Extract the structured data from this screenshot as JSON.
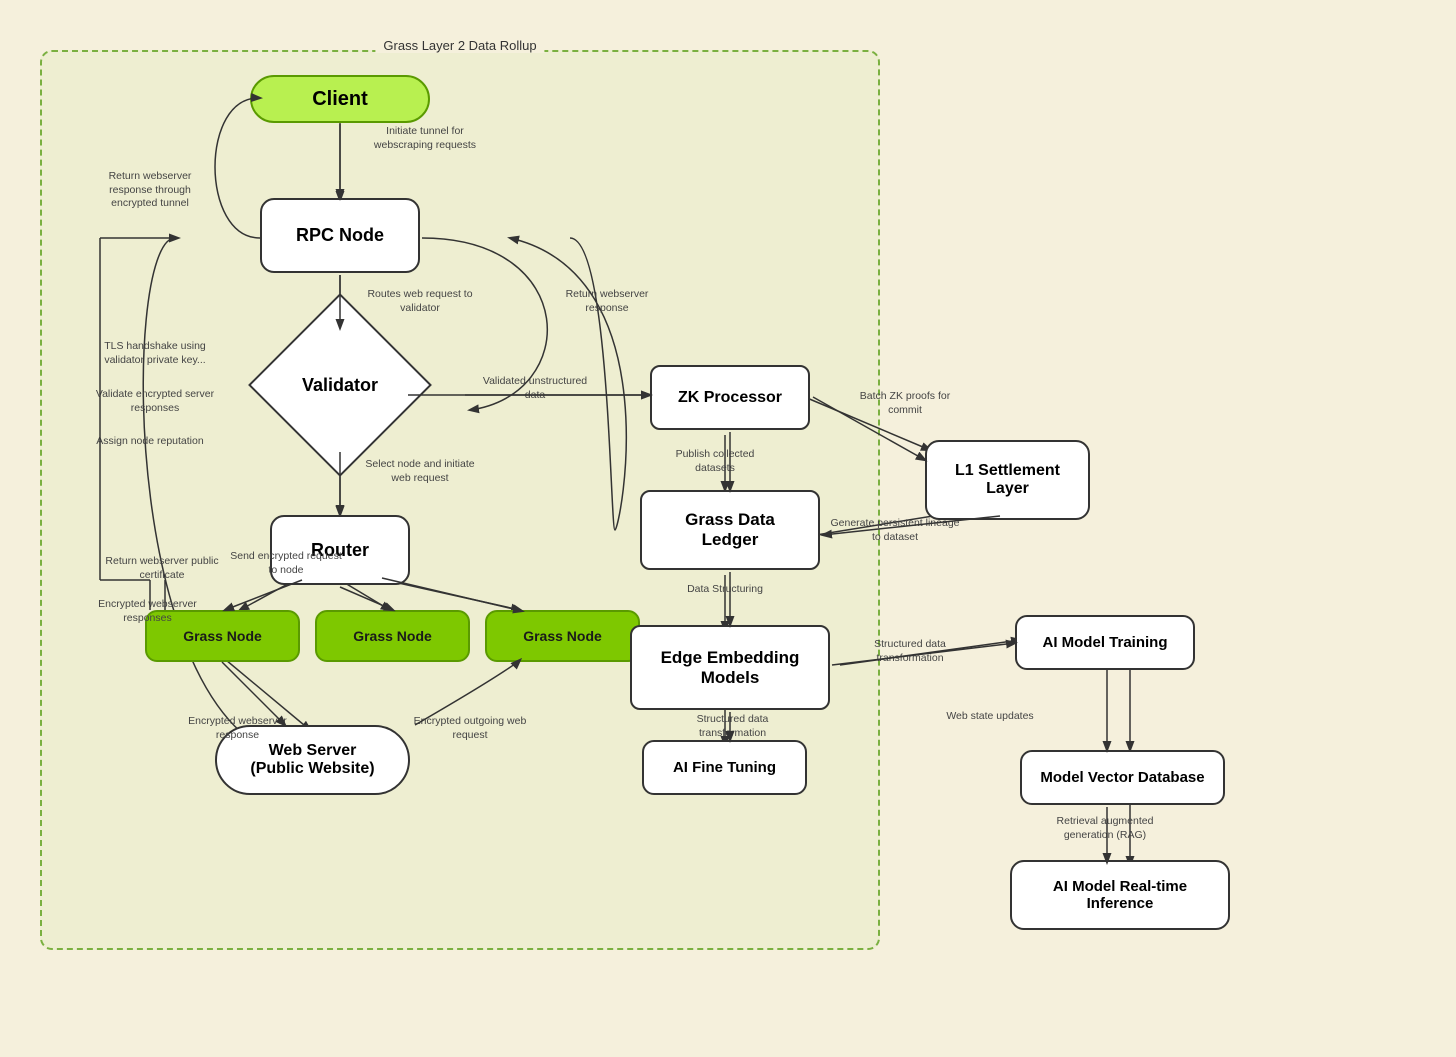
{
  "diagram": {
    "title": "Grass Layer 2 Data Rollup",
    "nodes": {
      "client": "Client",
      "rpcNode": "RPC Node",
      "validator": "Validator",
      "router": "Router",
      "grassNode1": "Grass Node",
      "grassNode2": "Grass Node",
      "grassNode3": "Grass Node",
      "webServer": "Web Server\n(Public Website)",
      "zkProcessor": "ZK Processor",
      "grassDataLedger": "Grass Data\nLedger",
      "edgeEmbeddingModels": "Edge Embedding\nModels",
      "l1SettlementLayer": "L1 Settlement\nLayer",
      "aiModelTraining": "AI Model Training",
      "aiFineTuning": "AI Fine Tuning",
      "modelVectorDatabase": "Model Vector Database",
      "aiModelRealTimeInference": "AI Model Real-time\nInference"
    },
    "labels": {
      "inititateTunnel": "Initiate tunnel for\nwebscraping requests",
      "returnWebserver": "Return webserver\nresponse through\nencrypted tunnel",
      "routesWebRequest": "Routes web request\nto validator",
      "returnWebserverResponse": "Return webserver\nresponse",
      "tlsHandshake": "TLS handshake using\nvalidator private key...",
      "validateEncrypted": "Validate encrypted\nserver responses",
      "assignNodeReputation": "Assign node\nreputation",
      "selectNode": "Select node and initiate\nweb request",
      "validatedUnstructuredData": "Validated\nunstructured data",
      "batchZkProofs": "Batch ZK proofs\nfor commit",
      "publishCollectedDatasets": "Publish collected\ndatasets",
      "generatePersistentLineage": "Generate persistent\nlineage to dataset",
      "dataStructuring": "Data Structuring",
      "structuredDataTransformation": "Structured data\ntransformation",
      "structuredDataTransformation2": "Structured data\ntransformation",
      "webStateUpdates": "Web state\nupdates",
      "sendEncryptedRequest": "Send encrypted\nrequest to node",
      "encryptedWebserverResponse": "Encrypted webserver\nresponse",
      "encryptedOutgoingWebRequest": "Encrypted outgoing\nweb request",
      "returnWebserverPublicCertificate": "Return webserver\npublic certificate",
      "encryptedWebserverResponses": "Encrypted webserver\nresponses",
      "retrievalAugmented": "Retrieval augmented\ngeneration (RAG)"
    }
  }
}
